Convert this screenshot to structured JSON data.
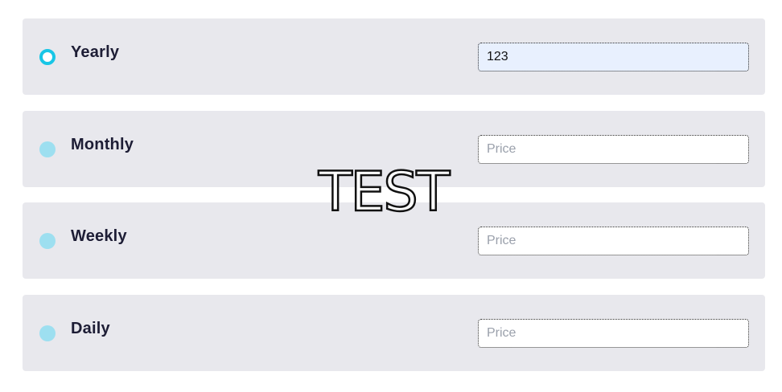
{
  "options": [
    {
      "label": "Yearly",
      "selected": true,
      "value": "123",
      "placeholder": "Price"
    },
    {
      "label": "Monthly",
      "selected": false,
      "value": "",
      "placeholder": "Price"
    },
    {
      "label": "Weekly",
      "selected": false,
      "value": "",
      "placeholder": "Price"
    },
    {
      "label": "Daily",
      "selected": false,
      "value": "",
      "placeholder": "Price"
    }
  ],
  "overlay": {
    "text": "TEST"
  },
  "colors": {
    "row_background": "#e8e8ed",
    "radio_selected": "#18c6e6",
    "radio_unselected": "#9ddff0",
    "label_text": "#1d1d35",
    "filled_input_background": "#e8f0fe"
  },
  "icons": {
    "radio_selected": "radio-selected-icon",
    "radio_unselected": "radio-unselected-icon"
  }
}
